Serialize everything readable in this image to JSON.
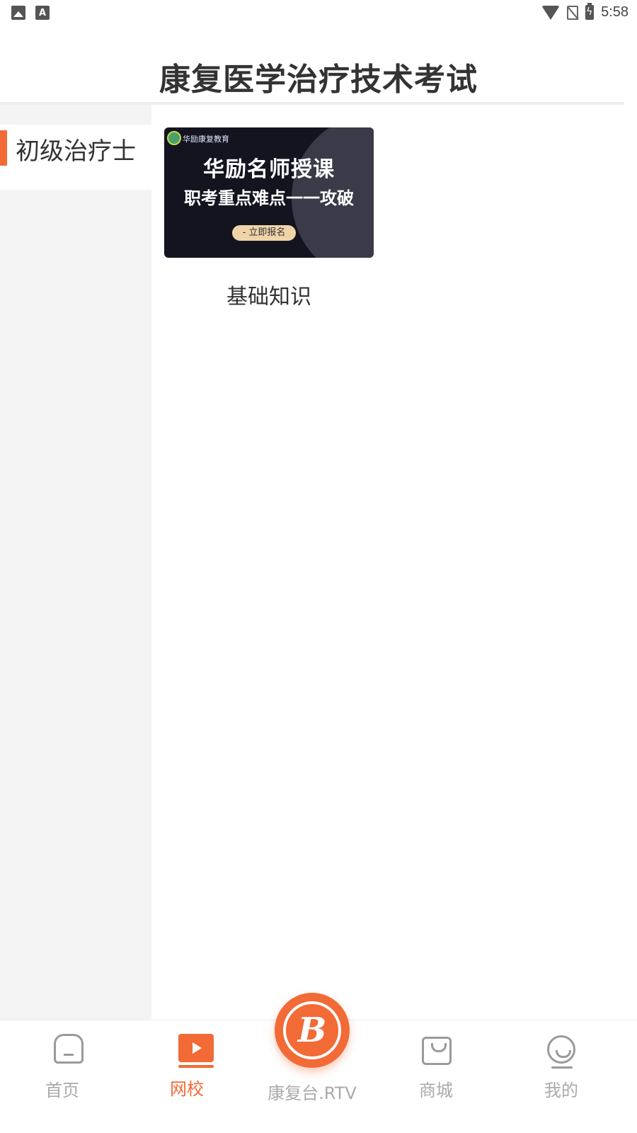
{
  "status_bar": {
    "time": "5:58",
    "left_icons": [
      "image-icon",
      "font-icon"
    ],
    "right_icons": [
      "wifi-icon",
      "no-sim-icon",
      "battery-charging-icon"
    ]
  },
  "header": {
    "title": "康复医学治疗技术考试"
  },
  "sidebar": {
    "items": [
      {
        "label": "初级治疗士",
        "selected": true
      }
    ]
  },
  "courses": [
    {
      "name": "基础知识",
      "banner": {
        "org": "华励康复教育",
        "line1": "华励名师授课",
        "line2": "职考重点难点一一攻破",
        "button": "- 立即报名"
      }
    }
  ],
  "bottom_nav": {
    "items": [
      {
        "label": "首页",
        "icon": "home-icon",
        "active": false
      },
      {
        "label": "网校",
        "icon": "play-icon",
        "active": true
      },
      {
        "label": "康复台.RTV",
        "icon": "logo-b-icon",
        "active": false
      },
      {
        "label": "商城",
        "icon": "shopping-bag-icon",
        "active": false
      },
      {
        "label": "我的",
        "icon": "profile-icon",
        "active": false
      }
    ],
    "center_logo_letter": "B"
  },
  "colors": {
    "accent": "#f26a36",
    "inactive": "#aaaaaa",
    "sidebar_bg": "#f4f4f4"
  }
}
